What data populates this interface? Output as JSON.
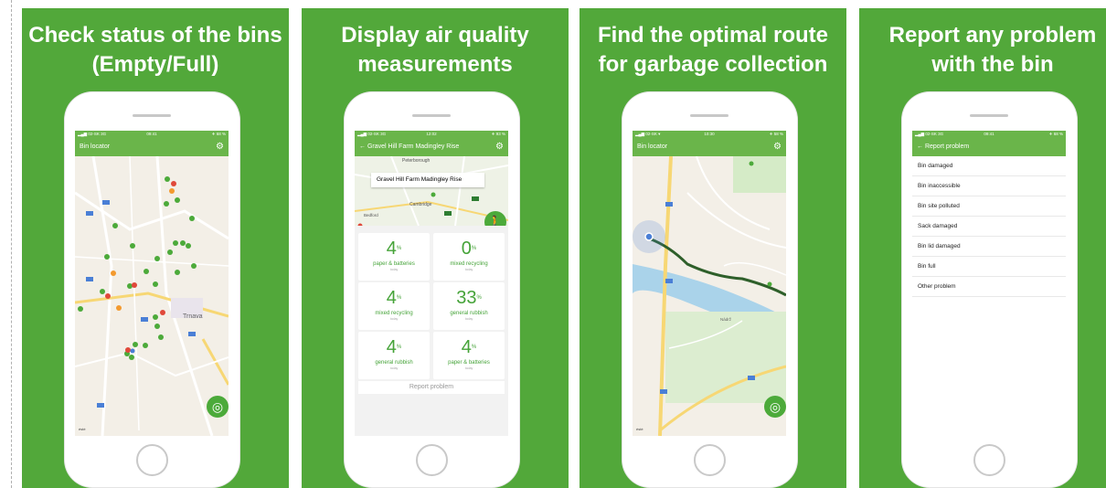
{
  "panels": [
    {
      "heading": "Check status of the bins (Empty/Full)",
      "status": {
        "left": "▂▄▆ 02-SK 3G",
        "time": "09:41",
        "right": "✈ 68 %"
      },
      "appbar_title": "Bin locator",
      "map": {
        "town_label": "Trnava",
        "corner_label": "ésté"
      }
    },
    {
      "heading": "Display air quality measurements",
      "status": {
        "left": "▂▄▆ 02-SK 3G",
        "time": "12:02",
        "right": "✈ 93 %"
      },
      "appbar_title": "← Gravel Hill Farm Madingley Rise",
      "map": {
        "search": "Gravel Hill Farm Madingley Rise",
        "label_1": "Peterborough",
        "label_2": "Cambridge",
        "label_3": "Bedford"
      },
      "measurements": [
        {
          "value": "4",
          "unit": "%",
          "label": "paper & batteries",
          "sub": "today"
        },
        {
          "value": "0",
          "unit": "%",
          "label": "mixed recycling",
          "sub": "today"
        },
        {
          "value": "4",
          "unit": "%",
          "label": "mixed recycling",
          "sub": "today"
        },
        {
          "value": "33",
          "unit": "%",
          "label": "general rubbish",
          "sub": "today"
        },
        {
          "value": "4",
          "unit": "%",
          "label": "general rubbish",
          "sub": "today"
        },
        {
          "value": "4",
          "unit": "%",
          "label": "paper & batteries",
          "sub": "today"
        }
      ],
      "report_button": "Report problem"
    },
    {
      "heading": "Find the optimal route for garbage collection",
      "status": {
        "left": "▂▄▆ 02-SK ▾",
        "time": "10:30",
        "right": "✈ 58 %"
      },
      "appbar_title": "Bin locator",
      "map": {
        "corner_label": "ésté",
        "area_label": "Nádrž"
      }
    },
    {
      "heading": "Report any problem with the bin",
      "status": {
        "left": "▂▄▆ 02-SK 3G",
        "time": "09:41",
        "right": "✈ 68 %"
      },
      "appbar_title": "← Report problem",
      "problems": [
        "Bin damaged",
        "Bin inaccessible",
        "Bin site polluted",
        "Sack damaged",
        "Bin lid damaged",
        "Bin full",
        "Other problem"
      ]
    }
  ],
  "colors": {
    "panel_bg": "#52a83a",
    "app_green": "#6ab54a",
    "bin_empty": "#4caa3a",
    "bin_full": "#e0483a",
    "bin_half": "#f39a2f"
  },
  "icons": [
    "gear-icon",
    "locate-icon",
    "walk-icon",
    "back-arrow-icon",
    "signal-icon",
    "battery-icon"
  ]
}
